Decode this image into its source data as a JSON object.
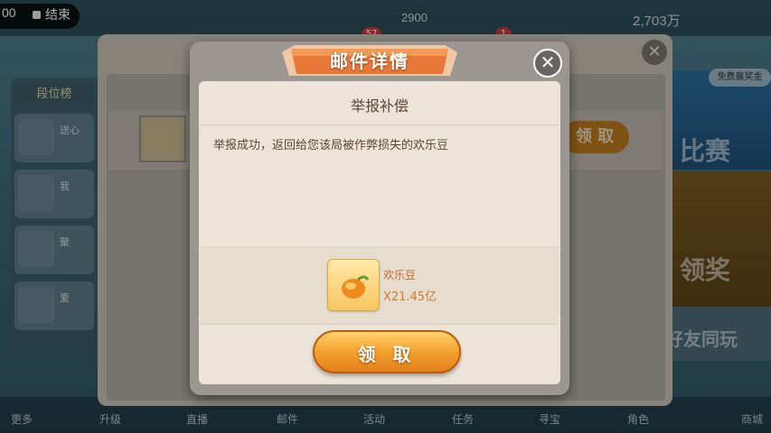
{
  "status_bar": {
    "recording_time": "00",
    "end_label": "结束"
  },
  "background": {
    "left_tab": "段位榜",
    "friends": [
      "送心",
      "我",
      "聚",
      "爱"
    ],
    "top_counts": [
      "2900",
      "2,703万"
    ],
    "mail_badge": "57",
    "tab_badge": "1",
    "bg_tab_label": "件",
    "bg_claim_label": "领 取",
    "right_panels": [
      "比赛",
      "领奖",
      "好友同玩"
    ],
    "free_match": "免费赢奖金",
    "bottom_nav": [
      "更多",
      "升级",
      "直播",
      "邮件",
      "活动",
      "任务",
      "寻宝",
      "角色",
      "商城"
    ]
  },
  "modal": {
    "title": "邮件详情",
    "subtitle": "举报补偿",
    "message": "举报成功，返回给您该局被作弊损失的欢乐豆",
    "reward": {
      "name": "欢乐豆",
      "quantity": "X21.45亿",
      "icon": "bean-icon"
    },
    "claim_label": "领 取",
    "close_icon": "close-icon"
  },
  "colors": {
    "accent": "#f5a531",
    "title_banner": "#e8783a",
    "reward_text": "#d4782b"
  }
}
